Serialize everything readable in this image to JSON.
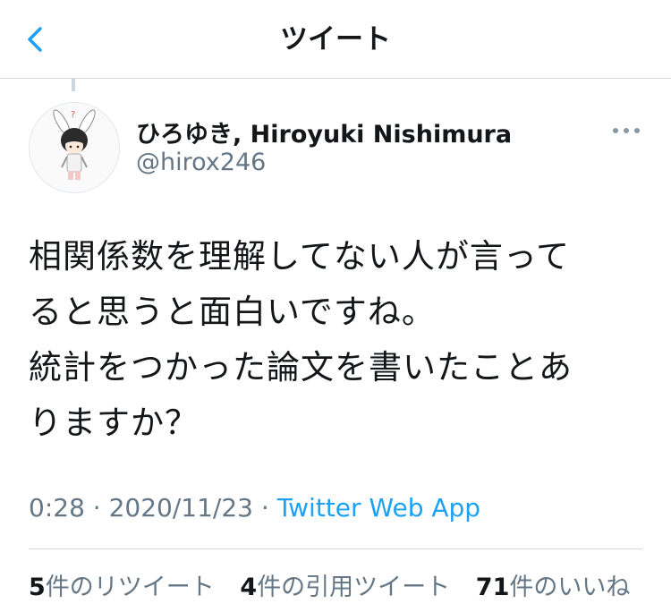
{
  "header": {
    "title": "ツイート",
    "back_icon": "chevron-left-icon",
    "accent_color": "#1da1f2"
  },
  "tweet": {
    "author": {
      "display_name": "ひろゆき, Hiroyuki Nishimura",
      "handle": "@hirox246",
      "avatar_icon": "avatar-image"
    },
    "more_icon": "more-options-icon",
    "text_lines": [
      "相関係数を理解してない人が言って",
      "ると思うと面白いですね。",
      "統計をつかった論文を書いたことあ",
      "りますか？"
    ],
    "time": "0:28",
    "separator": " · ",
    "date": "2020/11/23",
    "source": "Twitter Web App"
  },
  "stats": {
    "retweets_count": "5",
    "retweets_label": "件のリツイート",
    "quotes_count": "4",
    "quotes_label": "件の引用ツイート",
    "likes_count": "71",
    "likes_label": "件のいいね"
  }
}
